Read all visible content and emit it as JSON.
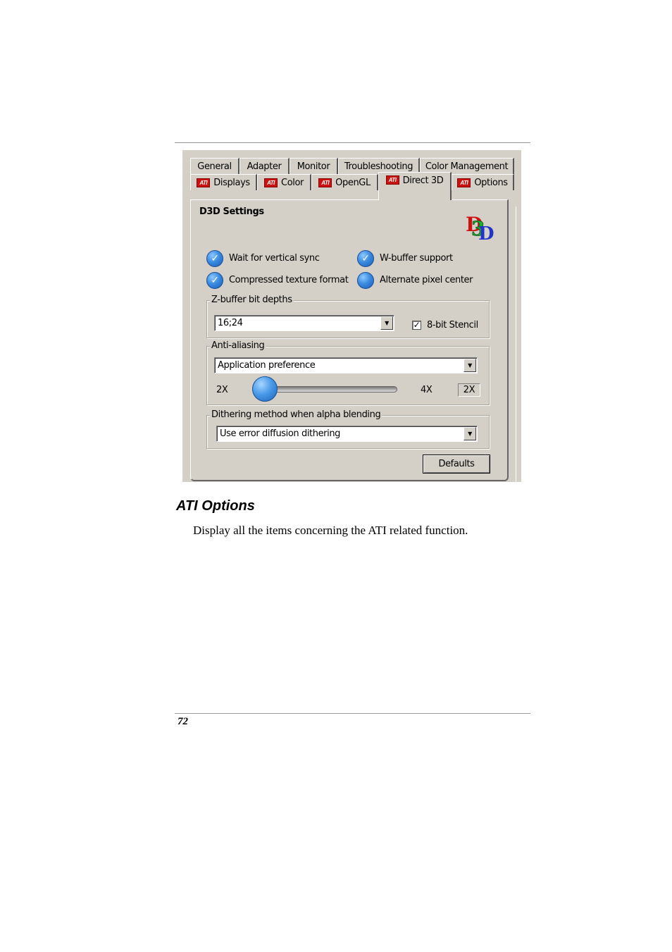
{
  "tabs_row1": [
    "General",
    "Adapter",
    "Monitor",
    "Troubleshooting",
    "Color Management"
  ],
  "tabs_row2": [
    {
      "label": "Displays",
      "icon": "ati-logo-icon"
    },
    {
      "label": "Color",
      "icon": "ati-logo-icon"
    },
    {
      "label": "OpenGL",
      "icon": "ati-logo-icon"
    },
    {
      "label": "Direct 3D",
      "icon": "ati-logo-icon",
      "active": true
    },
    {
      "label": "Options",
      "icon": "ati-logo-icon"
    }
  ],
  "ati_logo_text": "ATI",
  "d3d": {
    "title": "D3D Settings",
    "logo_icon": "d3d-logo-icon",
    "options": [
      {
        "label": "Wait for vertical sync",
        "checked": true
      },
      {
        "label": "W-buffer support",
        "checked": true
      },
      {
        "label": "Compressed texture format",
        "checked": true
      },
      {
        "label": "Alternate pixel center",
        "checked": false
      }
    ],
    "checkmark": "✓",
    "zbuffer": {
      "legend": "Z-buffer bit depths",
      "value": "16;24",
      "stencil_label": "8-bit Stencil",
      "stencil_checked": true,
      "stencil_mark": "✓"
    },
    "antialiasing": {
      "legend": "Anti-aliasing",
      "value": "Application preference",
      "slider_min_label": "2X",
      "slider_max_label": "4X",
      "slider_value_label": "2X",
      "slider_position": 0
    },
    "dithering": {
      "legend": "Dithering method when alpha blending",
      "value": "Use error diffusion dithering"
    },
    "defaults_button": "Defaults",
    "dropdown_arrow": "▼"
  },
  "section_heading": "ATI Options",
  "section_text": "Display all the items concerning the ATI related function.",
  "page_number": "72"
}
